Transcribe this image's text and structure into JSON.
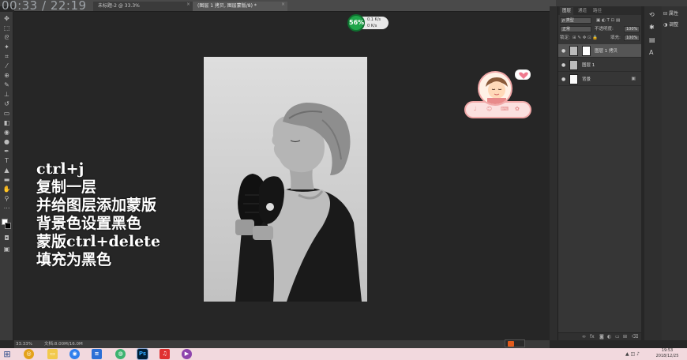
{
  "video": {
    "timer": "00:33 / 22:19"
  },
  "document_tabs": [
    {
      "label": "未标题-2 @ 33.3%",
      "active": false
    },
    {
      "label": "(图层 1 拷贝, 图层蒙版/8) *",
      "active": true
    }
  ],
  "tab_close_glyph": "×",
  "overlay_text": {
    "line1": "ctrl+j",
    "line2": "复制一层",
    "line3": "并给图层添加蒙版",
    "line4": "背景色设置黑色",
    "line5": "蒙版ctrl+delete",
    "line6": "填充为黑色"
  },
  "speed_widget": {
    "percent": "56%",
    "up": "0.1 K/s",
    "down": "0 K/s"
  },
  "layers_panel": {
    "tabs": [
      "图层",
      "通道",
      "路径"
    ],
    "kind_label": "ρ 类型",
    "blend_mode": "正常",
    "opacity_label": "不透明度:",
    "opacity_value": "100%",
    "lock_label": "锁定:",
    "fill_label": "填充:",
    "fill_value": "100%",
    "layers": [
      {
        "name": "图层 1 拷贝",
        "selected": true,
        "has_mask": true
      },
      {
        "name": "图层 1",
        "selected": false,
        "has_mask": false
      },
      {
        "name": "背景",
        "selected": false,
        "has_mask": false,
        "locked": true
      }
    ],
    "footer_icons": [
      "link-icon",
      "fx-icon",
      "mask-icon",
      "adjustment-icon",
      "folder-icon",
      "new-layer-icon",
      "trash-icon"
    ]
  },
  "right_panel": {
    "items": [
      {
        "icon": "properties-icon",
        "label": "属性"
      },
      {
        "icon": "adjustments-icon",
        "label": "调整"
      }
    ]
  },
  "status_bar": {
    "zoom": "33.33%",
    "doc_info": "文档:8.00M/16.0M"
  },
  "taskbar": {
    "clock_time": "19:53",
    "clock_date": "2018/12/25"
  },
  "colors": {
    "workspace": "#262626",
    "panel": "#363636",
    "accent_green": "#1fa54a",
    "widget_pink": "#f1a8a8"
  }
}
